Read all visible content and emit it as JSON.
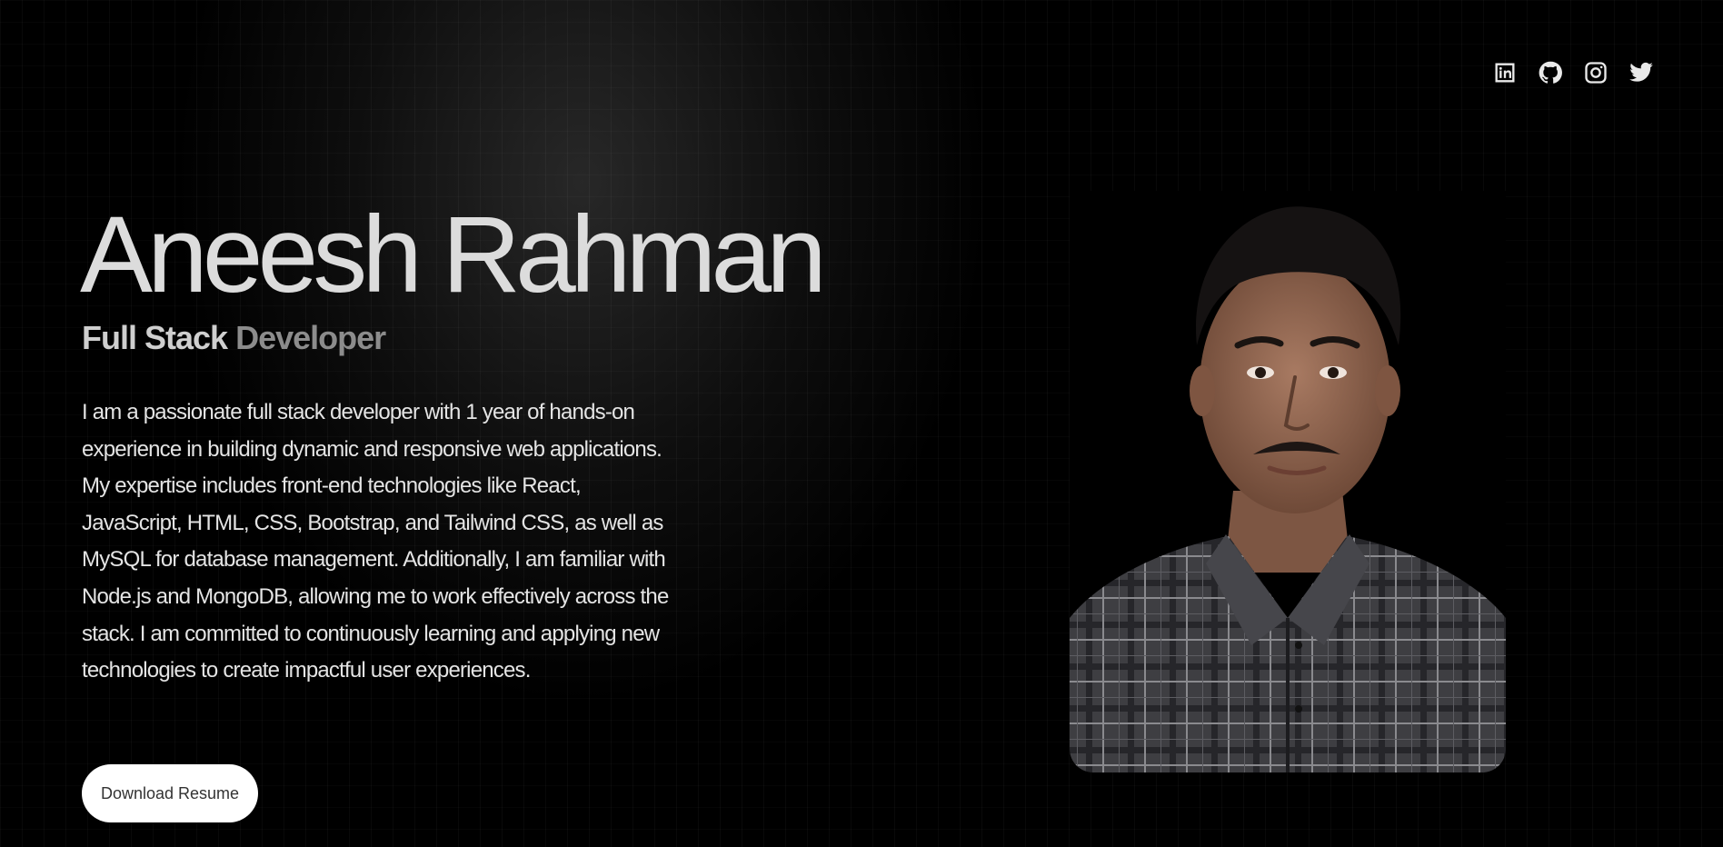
{
  "social": {
    "linkedin": "linkedin-icon",
    "github": "github-icon",
    "instagram": "instagram-icon",
    "twitter": "twitter-icon"
  },
  "hero": {
    "name": "Aneesh Rahman",
    "role_primary": "Full Stack",
    "role_secondary": "Developer",
    "bio": "I am a passionate full stack developer with 1 year of hands-on experience in building dynamic and responsive web applications. My expertise includes front-end technologies like React, JavaScript, HTML, CSS, Bootstrap, and Tailwind CSS, as well as MySQL for database management. Additionally, I am familiar with Node.js and MongoDB, allowing me to work effectively across the stack. I am committed to continuously learning and applying new technologies to create impactful user experiences.",
    "resume_button": "Download Resume"
  },
  "colors": {
    "background": "#000000",
    "text": "#dcdcdc",
    "button_bg": "#ffffff"
  }
}
